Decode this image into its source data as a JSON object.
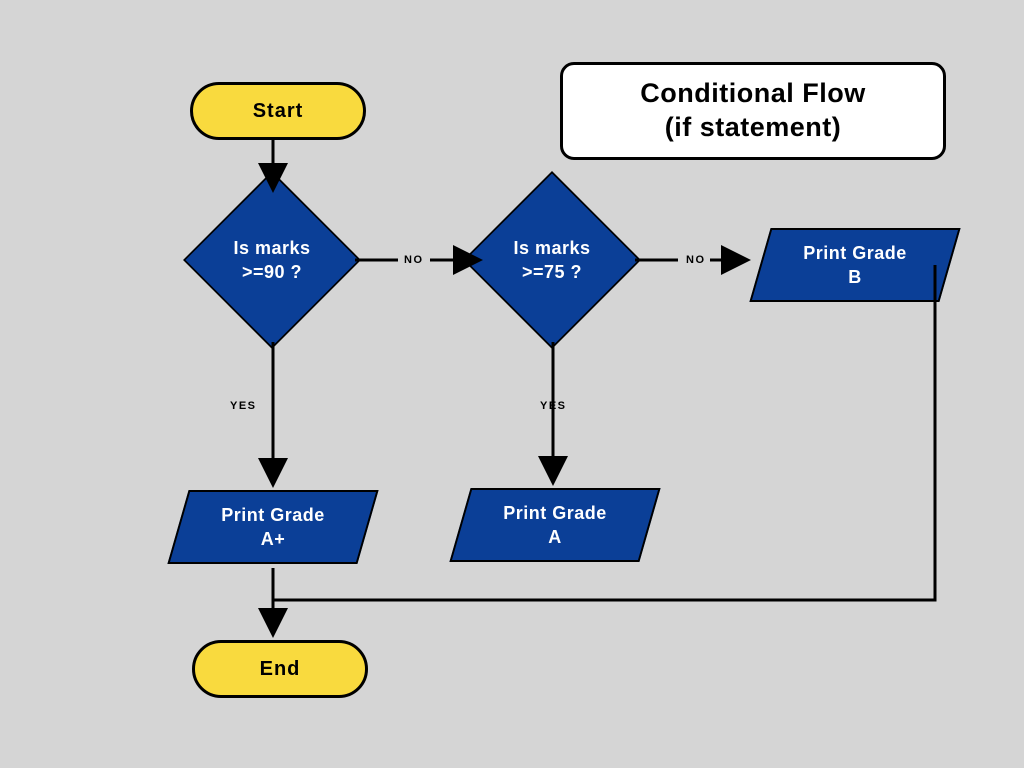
{
  "title": {
    "line1": "Conditional Flow",
    "line2": "(if statement)"
  },
  "nodes": {
    "start": "Start",
    "end": "End",
    "decision1": {
      "line1": "Is marks",
      "line2": ">=90 ?"
    },
    "decision2": {
      "line1": "Is marks",
      "line2": ">=75 ?"
    },
    "outA": {
      "line1": "Print Grade",
      "line2": "A+"
    },
    "outA2": {
      "line1": "Print Grade",
      "line2": "A"
    },
    "outB": {
      "line1": "Print Grade",
      "line2": "B"
    }
  },
  "edges": {
    "yes": "YES",
    "no": "NO"
  },
  "colors": {
    "terminatorFill": "#f9da3e",
    "processFill": "#0b3f97",
    "bg": "#d5d5d5"
  }
}
